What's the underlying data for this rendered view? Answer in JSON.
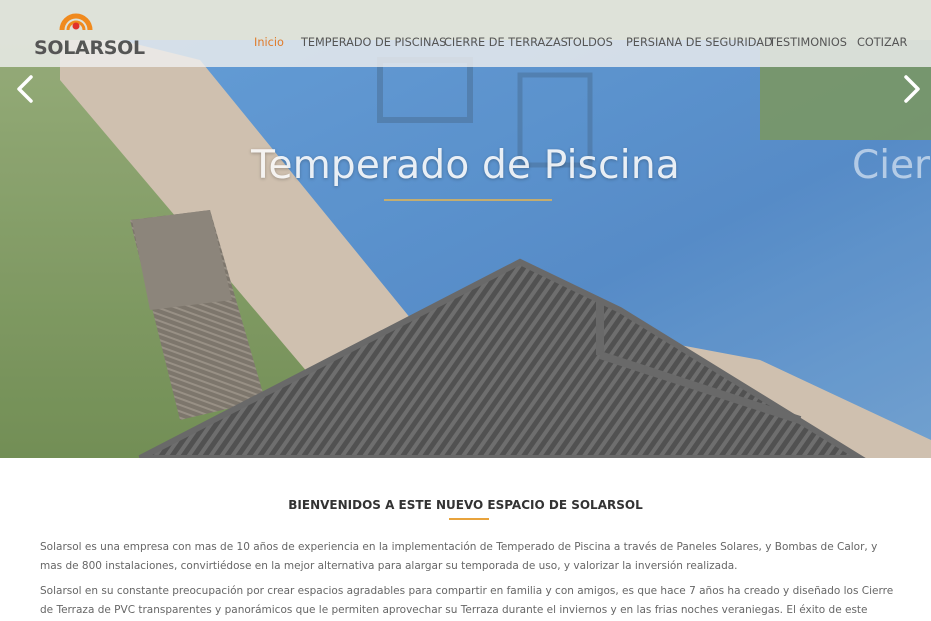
{
  "brand": {
    "name": "SOLARSOL",
    "colors": {
      "accent": "#e07b2a",
      "logo_ring": "#f08a1e",
      "logo_dot": "#e0302b",
      "underline": "#e8a33c"
    }
  },
  "nav": {
    "items": [
      {
        "label": "Inicio",
        "active": true
      },
      {
        "label": "TEMPERADO DE PISCINAS",
        "active": false
      },
      {
        "label": "CIERRE DE TERRAZAS",
        "active": false
      },
      {
        "label": "TOLDOS",
        "active": false
      },
      {
        "label": "PERSIANA DE SEGURIDAD",
        "active": false
      },
      {
        "label": "TESTIMONIOS",
        "active": false
      },
      {
        "label": "COTIZAR",
        "active": false
      }
    ]
  },
  "hero": {
    "title": "Temperado de Piscina",
    "next_title_peek": "Cier",
    "prev_icon": "chevron-left-icon",
    "next_icon": "chevron-right-icon"
  },
  "content": {
    "welcome_title": "BIENVENIDOS A ESTE NUEVO ESPACIO DE SOLARSOL",
    "paragraph1": "Solarsol es una empresa con mas de 10 años de experiencia en la implementación de Temperado de Piscina a través de Paneles Solares, y Bombas de Calor, y mas de 800 instalaciones, convirtiédose en la mejor alternativa para alargar su temporada de uso, y valorizar la inversión realizada.",
    "paragraph2": "Solarsol en su constante preocupación por crear espacios agradables para compartir en familia y con amigos, es que hace 7 años ha creado y diseñado los Cierre de Terraza de PVC transparentes y panorámicos que le permiten aprovechar su Terraza durante el inviernos y en las frias noches veraniegas. El éxito de este producto, nos ha permitido Diseñar y"
  }
}
